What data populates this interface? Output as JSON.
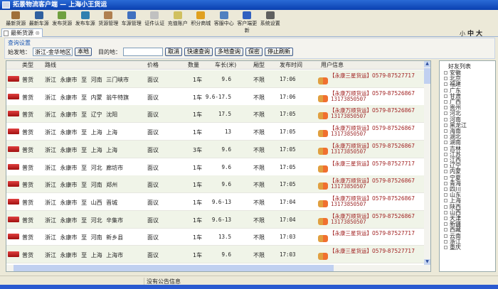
{
  "window": {
    "title": "拓景物流客户端 — 上海小王货运"
  },
  "toolbar": [
    "最新货源",
    "最新车源",
    "发布货源",
    "发布车源",
    "货源管理",
    "车源管理",
    "证件认证",
    "充值账户",
    "积分商城",
    "客服中心",
    "客户端更新",
    "系统设置"
  ],
  "toolbar_colors": [
    "#a0703a",
    "#3060a0",
    "#70a040",
    "#3080b0",
    "#b08050",
    "#4070c0",
    "#c0c0c0",
    "#d0c060",
    "#e0a020",
    "#5080c0",
    "#3060c0",
    "#606060"
  ],
  "tab": {
    "label": "最新货源"
  },
  "font_sizes": {
    "small": "小",
    "medium": "中",
    "large": "大"
  },
  "query": {
    "title": "查询设置",
    "origin_label": "始发地：",
    "origin_value": "浙江-金华地区",
    "local_btn": "本地",
    "dest_label": "目的地：",
    "dest_value": "",
    "buttons": [
      "取消",
      "快速查询",
      "多地查询",
      "保密",
      "停止刷新"
    ]
  },
  "table": {
    "headers": [
      "类型",
      "路线",
      "价格",
      "数量",
      "车长(米)",
      "厢型",
      "发布时间",
      "用户信息"
    ],
    "rows": [
      {
        "type": "普货",
        "route": "浙江 永康市 至 河南 三门峡市",
        "price": "面议",
        "count": "1车",
        "length": "9.6",
        "kind": "不限",
        "time": "17:06",
        "user": "【永康三星货运】0579-87527717",
        "phone": ""
      },
      {
        "type": "普货",
        "route": "浙江 永康市 至 内蒙 翁牛特旗",
        "price": "面议",
        "count": "1车",
        "length": "9.6-17.5",
        "kind": "不限",
        "time": "17:06",
        "user": "【永康万顺货运】0579-87526867",
        "phone": "13173850507"
      },
      {
        "type": "普货",
        "route": "浙江 永康市 至 辽宁 沈阳",
        "price": "面议",
        "count": "1车",
        "length": "17.5",
        "kind": "不限",
        "time": "17:05",
        "user": "【永康万顺货运】0579-87526867",
        "phone": "13173850507"
      },
      {
        "type": "普货",
        "route": "浙江 永康市 至 上海 上海",
        "price": "面议",
        "count": "1车",
        "length": "13",
        "kind": "不限",
        "time": "17:05",
        "user": "【永康万顺货运】0579-87526867",
        "phone": "13173850507"
      },
      {
        "type": "普货",
        "route": "浙江 永康市 至 上海 上海",
        "price": "面议",
        "count": "3车",
        "length": "9.6",
        "kind": "不限",
        "time": "17:05",
        "user": "【永康万顺货运】0579-87526867",
        "phone": "13173850507"
      },
      {
        "type": "普货",
        "route": "浙江 永康市 至 河北 廊坊市",
        "price": "面议",
        "count": "1车",
        "length": "9.6",
        "kind": "不限",
        "time": "17:05",
        "user": "【永康三星货运】0579-87527717",
        "phone": ""
      },
      {
        "type": "普货",
        "route": "浙江 永康市 至 河南 郑州",
        "price": "面议",
        "count": "1车",
        "length": "9.6",
        "kind": "不限",
        "time": "17:05",
        "user": "【永康万顺货运】0579-87526867",
        "phone": "13173850507"
      },
      {
        "type": "普货",
        "route": "浙江 永康市 至 山西 晋城",
        "price": "面议",
        "count": "1车",
        "length": "9.6-13",
        "kind": "不限",
        "time": "17:04",
        "user": "【永康万顺货运】0579-87526867",
        "phone": "13173850507"
      },
      {
        "type": "普货",
        "route": "浙江 永康市 至 河北 辛集市",
        "price": "面议",
        "count": "1车",
        "length": "9.6-13",
        "kind": "不限",
        "time": "17:04",
        "user": "【永康万顺货运】0579-87526867",
        "phone": "13173850507"
      },
      {
        "type": "普货",
        "route": "浙江 永康市 至 河南 新乡县",
        "price": "面议",
        "count": "1车",
        "length": "13.5",
        "kind": "不限",
        "time": "17:03",
        "user": "【永康三星货运】0579-87527717",
        "phone": ""
      },
      {
        "type": "普货",
        "route": "浙江 永康市 至 上海 上海市",
        "price": "面议",
        "count": "1车",
        "length": "9.6",
        "kind": "不限",
        "time": "17:03",
        "user": "【永康三星货运】0579-87527717",
        "phone": ""
      }
    ]
  },
  "friends": {
    "title": "好友列表",
    "items": [
      "安徽",
      "北京",
      "福建",
      "广东",
      "甘肃",
      "广西",
      "贵州",
      "河北",
      "河南",
      "黑龙江",
      "海南",
      "湖北",
      "湖南",
      "吉林",
      "江苏",
      "江西",
      "辽宁",
      "内蒙",
      "宁夏",
      "青海",
      "四川",
      "山东",
      "上海",
      "陕西",
      "山西",
      "天津",
      "新疆",
      "西藏",
      "云南",
      "浙江",
      "重庆"
    ]
  },
  "status": {
    "notice": "没有公告信息"
  }
}
